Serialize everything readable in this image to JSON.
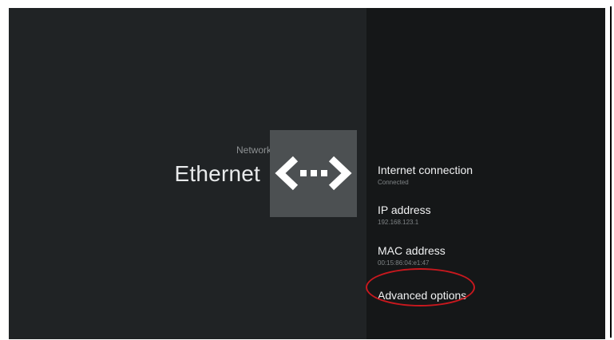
{
  "header": {
    "breadcrumb": "Network",
    "title": "Ethernet"
  },
  "icon": {
    "name": "ethernet-icon"
  },
  "settings": [
    {
      "label": "Internet connection",
      "value": "Connected"
    },
    {
      "label": "IP address",
      "value": "192.168.123.1"
    },
    {
      "label": "MAC address",
      "value": "00:15:86:04:e1:47"
    }
  ],
  "advanced": {
    "label": "Advanced options",
    "highlight_color": "#c8181e"
  },
  "colors": {
    "background": "#202325",
    "panel": "#151718",
    "icon_tile": "#4c5052"
  }
}
